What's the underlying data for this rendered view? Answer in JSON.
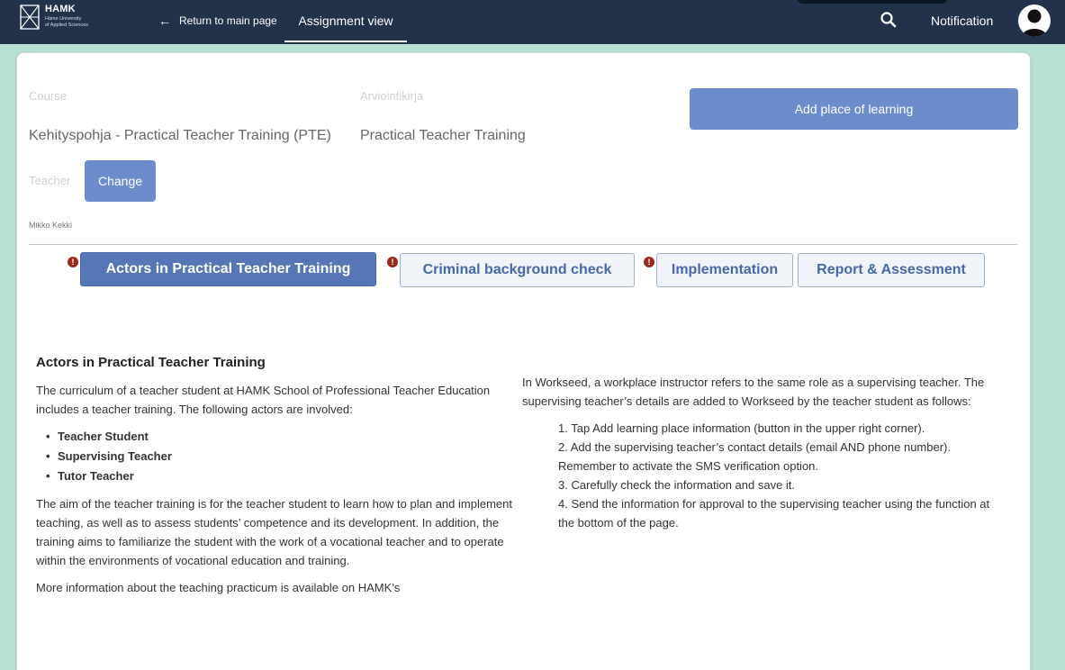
{
  "header": {
    "logo_name": "HAMK",
    "logo_sub_line1": "Häme University",
    "logo_sub_line2": "of Applied Sciences",
    "back_label": "Return to main page",
    "back_icon": "arrow-left-icon",
    "active_tab": "Assignment view",
    "notification_label": "Notification",
    "search_icon": "search-icon",
    "avatar_icon": "user-avatar-icon"
  },
  "details": {
    "course_label": "Course",
    "course_value": "Kehityspohja - Practical Teacher Training (PTE)",
    "book_label": "Arviointikirja",
    "book_value": "Practical Teacher Training",
    "teacher_label": "Teacher",
    "change_label": "Change",
    "teacher_name": "Mikko Kekki",
    "add_place_label": "Add place of learning"
  },
  "tabs": [
    {
      "label": "Actors in Practical Teacher Training",
      "active": true,
      "warning": true
    },
    {
      "label": "Criminal background check",
      "active": false,
      "warning": true
    },
    {
      "label": "Implementation",
      "active": false,
      "warning": true
    },
    {
      "label": "Report & Assessment",
      "active": false,
      "warning": false
    }
  ],
  "content": {
    "heading": "Actors in Practical Teacher Training",
    "intro": "The curriculum of a teacher student at HAMK School of Professional Teacher Education includes a teacher training. The following actors are involved:",
    "actors": [
      "Teacher Student",
      "Supervising Teacher",
      "Tutor Teacher"
    ],
    "aim": "The aim of the teacher training is for the teacher student to learn how to plan and implement teaching, as well as to assess students’ competence and its development. In addition, the training aims to familiarize the student with the work of a vocational teacher and to operate within the environments of vocational education and training.",
    "more_info": "More information about the teaching practicum is available on HAMK’s",
    "right_intro": "In Workseed, a workplace instructor refers to the same role as a supervising teacher. The supervising teacher’s details are added to Workseed by the teacher student as follows:",
    "steps": [
      "1. Tap Add learning place information (button in the upper right corner).",
      "2. Add the supervising teacher’s contact details (email AND phone number). Remember to activate the SMS verification option.",
      "3. Carefully check the information and save it.",
      "4. Send the information for approval to the supervising teacher using the function at the bottom of the page."
    ]
  },
  "colors": {
    "navbar": "#21324a",
    "accent": "#6d8ccb",
    "tab_active": "#5776b5",
    "warning": "#9a2a1e",
    "background": "#b6e1d4"
  }
}
